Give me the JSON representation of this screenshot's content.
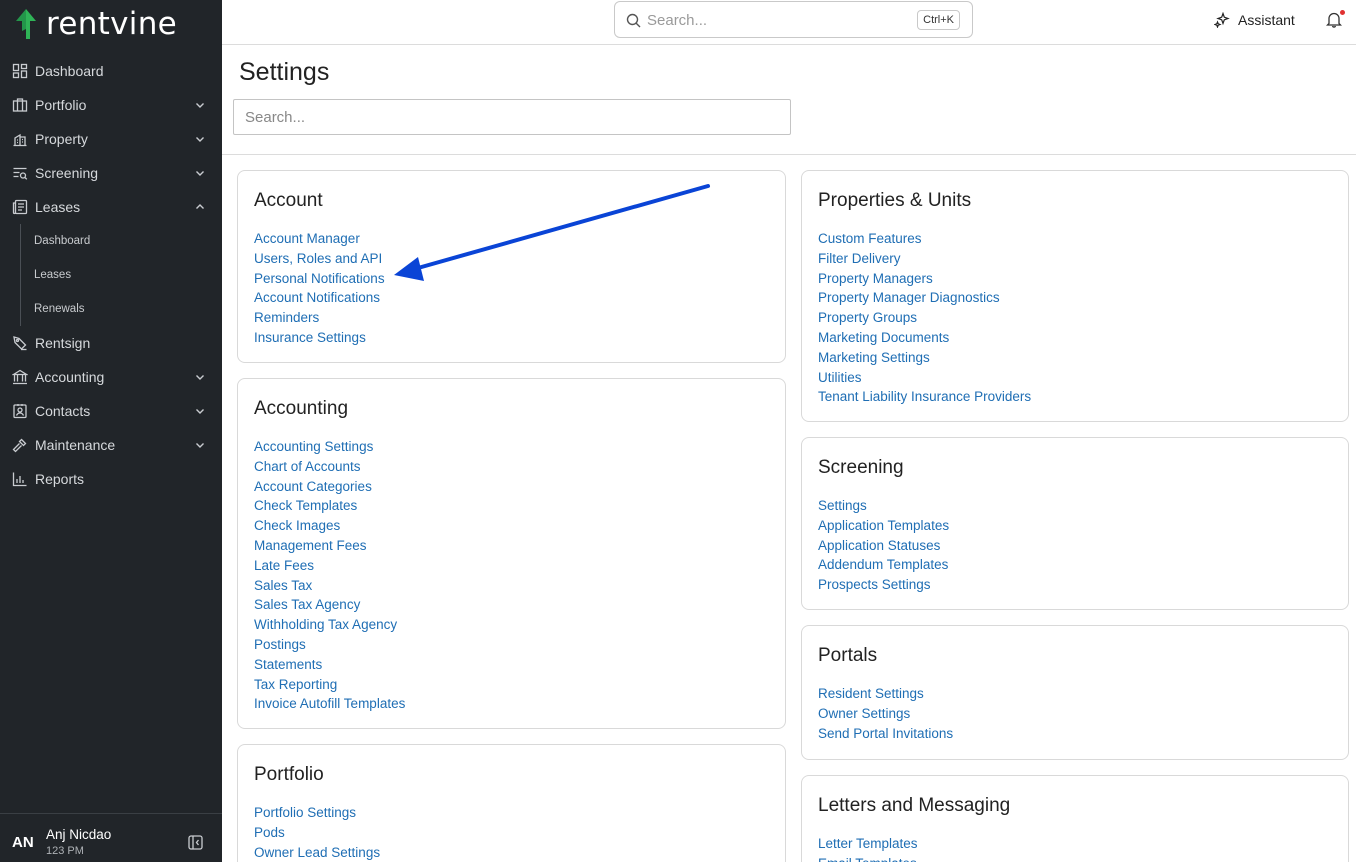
{
  "app": {
    "brand": "rentvine",
    "brand_color": "#2fb457",
    "link_color": "#1f6eb4",
    "annotation_color": "#0a44d6"
  },
  "sidebar": {
    "items": [
      {
        "label": "Dashboard",
        "icon": "dashboard-icon"
      },
      {
        "label": "Portfolio",
        "icon": "portfolio-icon",
        "chevron": "down"
      },
      {
        "label": "Property",
        "icon": "property-icon",
        "chevron": "down"
      },
      {
        "label": "Screening",
        "icon": "screening-icon",
        "chevron": "down"
      },
      {
        "label": "Leases",
        "icon": "leases-icon",
        "chevron": "up"
      },
      {
        "label": "Rentsign",
        "icon": "rentsign-icon"
      },
      {
        "label": "Accounting",
        "icon": "accounting-icon",
        "chevron": "down"
      },
      {
        "label": "Contacts",
        "icon": "contacts-icon",
        "chevron": "down"
      },
      {
        "label": "Maintenance",
        "icon": "maintenance-icon",
        "chevron": "down"
      },
      {
        "label": "Reports",
        "icon": "reports-icon"
      }
    ],
    "leases_sub": [
      "Dashboard",
      "Leases",
      "Renewals"
    ],
    "user": {
      "initials": "AN",
      "name": "Anj Nicdao",
      "time": "123 PM"
    }
  },
  "topbar": {
    "search_placeholder": "Search...",
    "shortcut": "Ctrl+K",
    "assistant_label": "Assistant"
  },
  "page": {
    "title": "Settings",
    "search_placeholder": "Search..."
  },
  "cards": {
    "account": {
      "title": "Account",
      "links": [
        "Account Manager",
        "Users, Roles and API",
        "Personal Notifications",
        "Account Notifications",
        "Reminders",
        "Insurance Settings"
      ]
    },
    "accounting": {
      "title": "Accounting",
      "links": [
        "Accounting Settings",
        "Chart of Accounts",
        "Account Categories",
        "Check Templates",
        "Check Images",
        "Management Fees",
        "Late Fees",
        "Sales Tax",
        "Sales Tax Agency",
        "Withholding Tax Agency",
        "Postings",
        "Statements",
        "Tax Reporting",
        "Invoice Autofill Templates"
      ]
    },
    "portfolio": {
      "title": "Portfolio",
      "links": [
        "Portfolio Settings",
        "Pods",
        "Owner Lead Settings"
      ]
    },
    "properties": {
      "title": "Properties & Units",
      "links": [
        "Custom Features",
        "Filter Delivery",
        "Property Managers",
        "Property Manager Diagnostics",
        "Property Groups",
        "Marketing Documents",
        "Marketing Settings",
        "Utilities",
        "Tenant Liability Insurance Providers"
      ]
    },
    "screening": {
      "title": "Screening",
      "links": [
        "Settings",
        "Application Templates",
        "Application Statuses",
        "Addendum Templates",
        "Prospects Settings"
      ]
    },
    "portals": {
      "title": "Portals",
      "links": [
        "Resident Settings",
        "Owner Settings",
        "Send Portal Invitations"
      ]
    },
    "letters": {
      "title": "Letters and Messaging",
      "links": [
        "Letter Templates",
        "Email Templates"
      ]
    }
  }
}
